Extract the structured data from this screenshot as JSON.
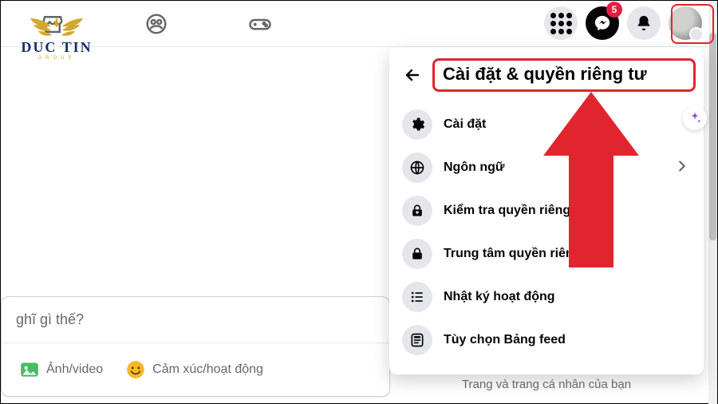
{
  "brand": {
    "name": "DUC TIN",
    "sub": "GROUP"
  },
  "nav": {
    "badge_count": "5"
  },
  "panel": {
    "title": "Cài đặt & quyền riêng tư",
    "items": [
      {
        "label": "Cài đặt",
        "icon": "gear-icon",
        "chevron": false
      },
      {
        "label": "Ngôn ngữ",
        "icon": "globe-icon",
        "chevron": true
      },
      {
        "label": "Kiểm tra quyền riêng tư",
        "icon": "lock-heart-icon",
        "chevron": false
      },
      {
        "label": "Trung tâm quyền riêng tư",
        "icon": "lock-icon",
        "chevron": false
      },
      {
        "label": "Nhật ký hoạt động",
        "icon": "list-icon",
        "chevron": false
      },
      {
        "label": "Tùy chọn Bảng feed",
        "icon": "feed-icon",
        "chevron": false
      }
    ]
  },
  "composer": {
    "placeholder": "ghĩ gì thế?",
    "photo_label": "Ảnh/video",
    "feeling_label": "Cảm xúc/hoạt động"
  },
  "footer_caption": "Trang và trang cá nhân của bạn"
}
